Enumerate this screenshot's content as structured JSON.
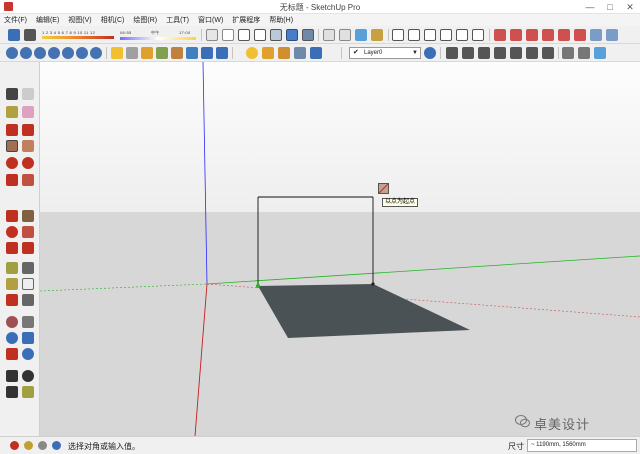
{
  "window": {
    "title": "无标题 - SketchUp Pro",
    "minimize": "—",
    "maximize": "□",
    "close": "✕"
  },
  "menu": [
    "文件(F)",
    "编辑(E)",
    "视图(V)",
    "相机(C)",
    "绘图(R)",
    "工具(T)",
    "窗口(W)",
    "扩展程序",
    "帮助(H)"
  ],
  "shadow_settings": {
    "time_ticks": "1 2 3 4 5 6 7 8 9 10 11 12",
    "light_start": "06:55",
    "light_mid": "中午",
    "light_end": "17:00"
  },
  "layers": {
    "current": "Layer0",
    "check": "✔",
    "arrow": "▼"
  },
  "viewport": {
    "tooltip": "以点为起点",
    "sky_color": "#ffffff",
    "ground_color": "#d7d7d7",
    "face_color": "#4a5256"
  },
  "status": {
    "message": "选择对角或输入值。",
    "measure_label": "尺寸",
    "measure_value": "~ 1190mm, 1560mm"
  },
  "watermark": "卓美设计",
  "colors": {
    "axis_red": "#c21f1f",
    "axis_green": "#23b423",
    "axis_blue": "#2a2aff"
  }
}
